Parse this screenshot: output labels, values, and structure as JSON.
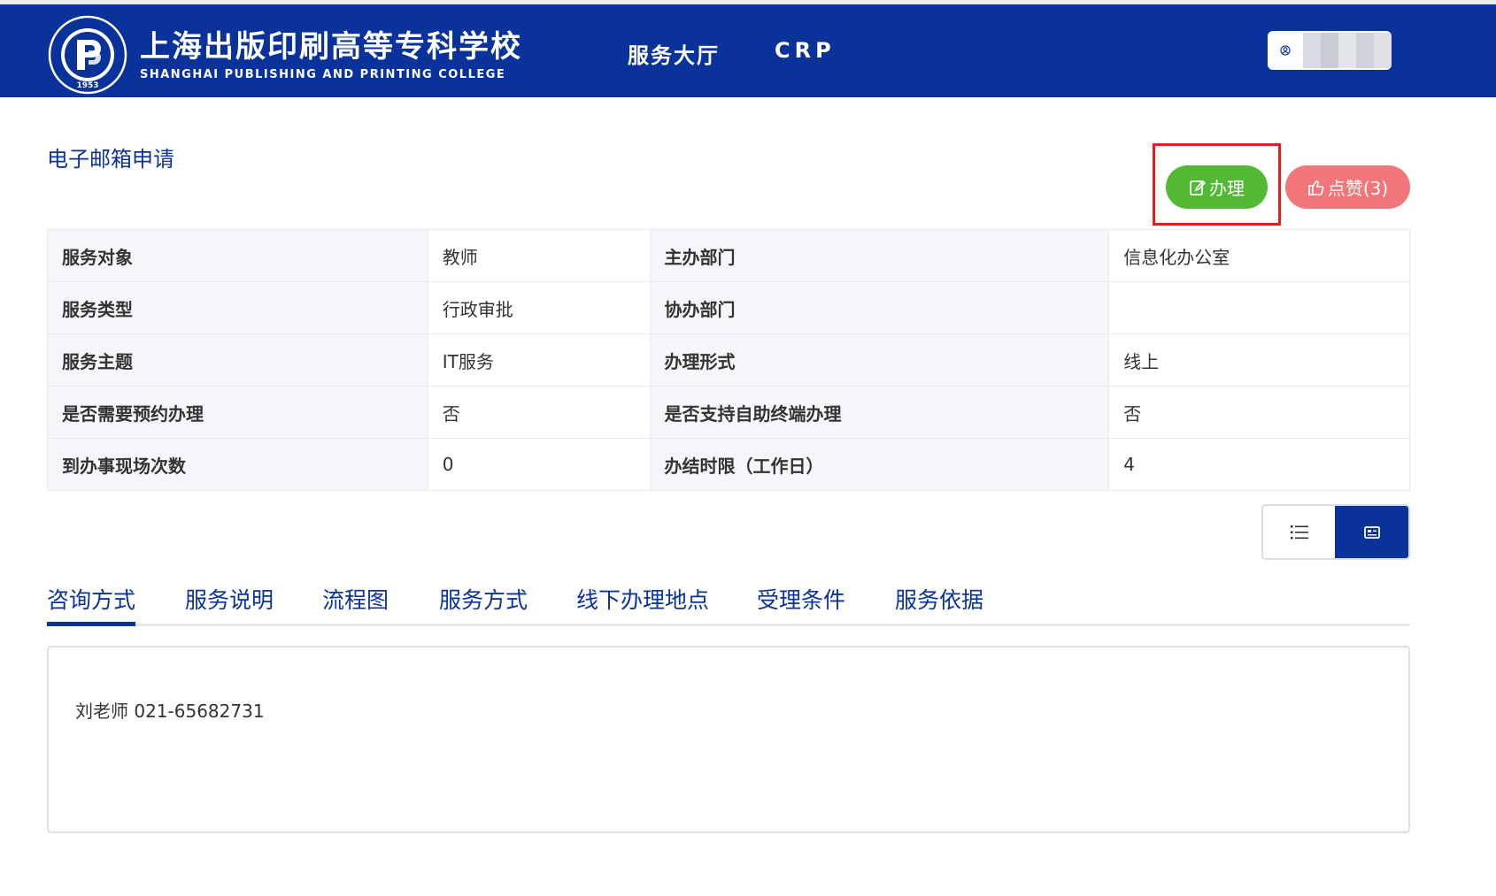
{
  "header": {
    "logo_cn": "上海出版印刷高等专科学校",
    "logo_en": "SHANGHAI PUBLISHING AND PRINTING COLLEGE",
    "seal_year": "1953",
    "nav": [
      {
        "label": "服务大厅"
      },
      {
        "label": "CRP"
      }
    ],
    "brand_color": "#0a329b"
  },
  "page": {
    "title": "电子邮箱申请",
    "actions": {
      "handle_label": "办理",
      "like_label": "点赞(3)"
    }
  },
  "info_table": [
    {
      "k1": "服务对象",
      "v1": "教师",
      "k2": "主办部门",
      "v2": "信息化办公室"
    },
    {
      "k1": "服务类型",
      "v1": "行政审批",
      "k2": "协办部门",
      "v2": ""
    },
    {
      "k1": "服务主题",
      "v1": "IT服务",
      "k2": "办理形式",
      "v2": "线上"
    },
    {
      "k1": "是否需要预约办理",
      "v1": "否",
      "k2": "是否支持自助终端办理",
      "v2": "否"
    },
    {
      "k1": "到办事现场次数",
      "v1": "0",
      "k2": "办结时限（工作日）",
      "v2": "4"
    }
  ],
  "view_toggle": {
    "options": [
      "list-icon",
      "card-icon"
    ],
    "active": "card-icon"
  },
  "tabs": [
    {
      "label": "咨询方式",
      "active": true
    },
    {
      "label": "服务说明"
    },
    {
      "label": "流程图"
    },
    {
      "label": "服务方式"
    },
    {
      "label": "线下办理地点"
    },
    {
      "label": "受理条件"
    },
    {
      "label": "服务依据"
    }
  ],
  "panel": {
    "content": "刘老师 021-65682731"
  },
  "colors": {
    "handle_button": "#52b934",
    "like_button": "#f07679",
    "highlight_box": "#e51c1c"
  }
}
